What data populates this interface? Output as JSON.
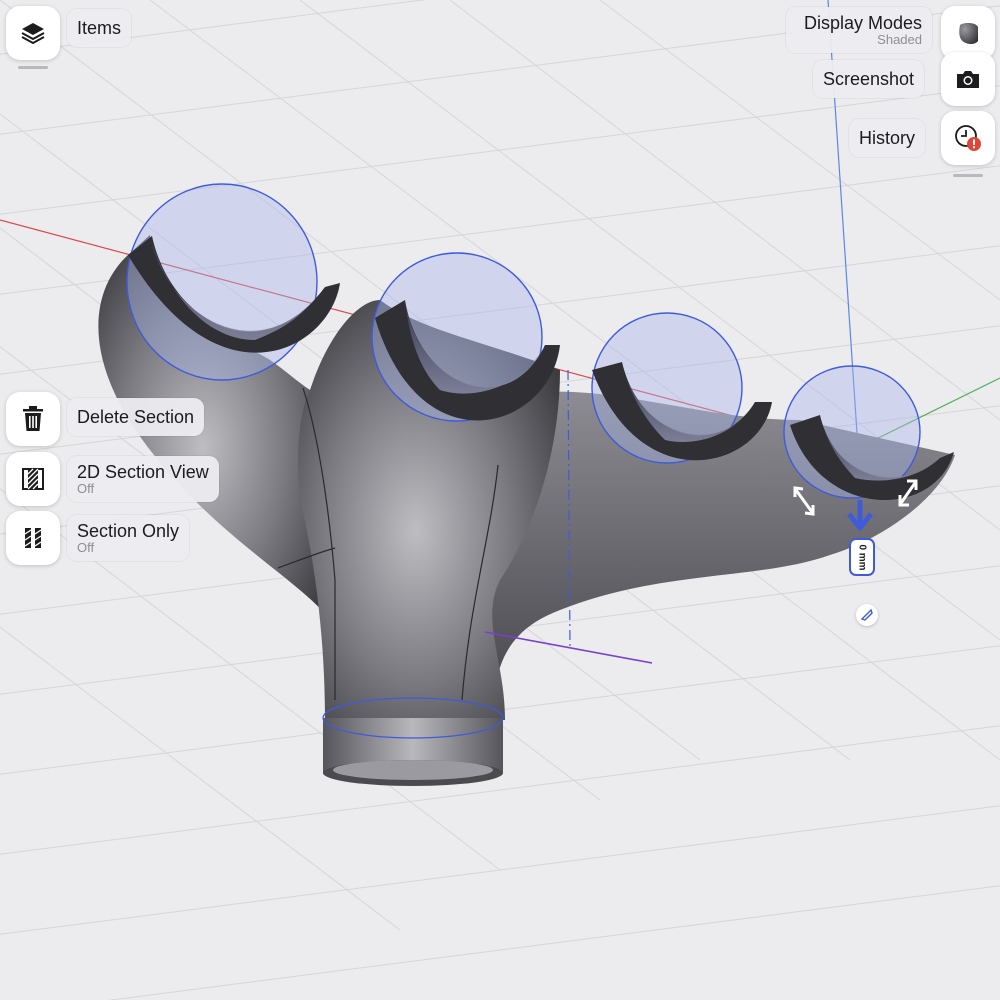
{
  "top_left": {
    "items_label": "Items",
    "items_icon": "layers-icon"
  },
  "top_right": {
    "display_modes": {
      "label": "Display Modes",
      "sublabel": "Shaded",
      "icon": "shaded-cube-icon"
    },
    "screenshot": {
      "label": "Screenshot",
      "icon": "camera-icon"
    },
    "history": {
      "label": "History",
      "icon": "history-clock-alert-icon"
    }
  },
  "section_panel": {
    "delete": {
      "label": "Delete Section",
      "icon": "trash-icon"
    },
    "view2d": {
      "label": "2D Section View",
      "sublabel": "Off",
      "icon": "section-view-icon"
    },
    "only": {
      "label": "Section Only",
      "sublabel": "Off",
      "icon": "section-only-icon"
    }
  },
  "viewport": {
    "offset_value": "0 mm",
    "accent_color": "#3f5bdc",
    "axis_x_color": "#d94b4b",
    "axis_y_color": "#55b05a",
    "axis_z_color": "#5b86e6"
  }
}
